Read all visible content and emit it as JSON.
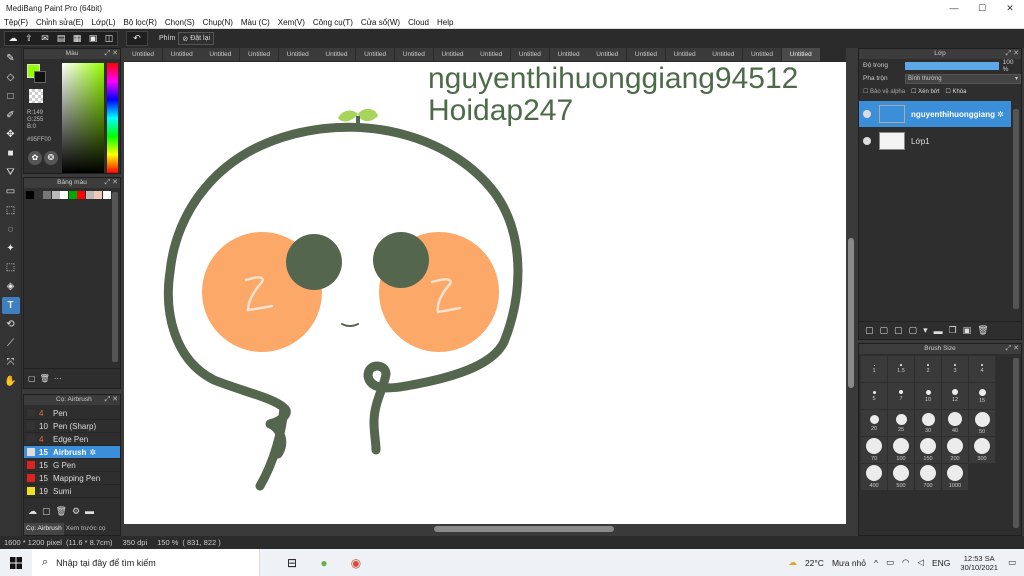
{
  "window": {
    "title": "MediBang Paint Pro (64bit)",
    "minimize": "—",
    "maximize": "☐",
    "close": "✕"
  },
  "menu": [
    "Tệp(F)",
    "Chỉnh sửa(E)",
    "Lớp(L)",
    "Bộ lọc(R)",
    "Chọn(S)",
    "Chụp(N)",
    "Màu (C)",
    "Xem(V)",
    "Công cụ(T)",
    "Cửa sổ(W)",
    "Cloud",
    "Help"
  ],
  "toolbar": {
    "phim_label": "Phím",
    "reset_label": "Đặt lại"
  },
  "tabs": [
    "Untitled",
    "Untitled",
    "Untitled",
    "Untitled",
    "Untitled",
    "Untitled",
    "Untitled",
    "Untitled",
    "Untitled",
    "Untitled",
    "Untitled",
    "Untitled",
    "Untitled",
    "Untitled",
    "Untitled",
    "Untitled",
    "Untitled",
    "Untitled"
  ],
  "color_panel": {
    "title": "Màu",
    "r": "R:149",
    "g": "G:255",
    "b": "B:0",
    "hex": "#95FF00",
    "fg_color": "#95ff00",
    "bg_color": "#111111"
  },
  "palette_panel": {
    "title": "Bảng màu",
    "swatches": [
      "#000000",
      "#333333",
      "#777777",
      "#bbbbbb",
      "#ffffff",
      "#00aa00",
      "#ff0000",
      "#bbbbbb",
      "#f4c8b8",
      "#ffffff"
    ],
    "dots": "···"
  },
  "brush_panel": {
    "title": "Cọ: Airbrush",
    "brushes": [
      {
        "size": "4",
        "name": "Pen",
        "color": "#333333"
      },
      {
        "size": "10",
        "name": "Pen (Sharp)",
        "color": "#333333"
      },
      {
        "size": "4",
        "name": "Edge Pen",
        "color": "#333333"
      },
      {
        "size": "15",
        "name": "Airbrush",
        "color": "#95ff00",
        "active": true
      },
      {
        "size": "15",
        "name": "G Pen",
        "color": "#dd2222"
      },
      {
        "size": "15",
        "name": "Mapping Pen",
        "color": "#dd2222"
      },
      {
        "size": "19",
        "name": "Sumi",
        "color": "#f0e020"
      }
    ],
    "bottom_tabs": [
      "Cọ: Airbrush",
      "Xem trước cọ"
    ]
  },
  "canvas": {
    "watermark_line1": "nguyenthihuonggiang94512",
    "watermark_line2": "Hoidap247",
    "line_color": "#55664f",
    "cheek_color": "#fba868",
    "sprout_color": "#a7d45a"
  },
  "layer_panel": {
    "title": "Lớp",
    "opacity_label": "Độ trong",
    "opacity_value": "100 %",
    "opacity_fraction": 1.0,
    "blend_label": "Pha trộn",
    "blend_value": "Bình thường",
    "protect_alpha": "Bảo vệ alpha",
    "clipping": "Xén bớt",
    "lock": "Khóa",
    "layers": [
      {
        "name": "nguyenthihuonggiang",
        "active": true
      },
      {
        "name": "Lớp1",
        "active": false
      }
    ]
  },
  "brush_size_panel": {
    "title": "Brush Size",
    "sizes": [
      "1",
      "1.5",
      "2",
      "3",
      "4",
      "5",
      "7",
      "10",
      "12",
      "15",
      "20",
      "25",
      "30",
      "40",
      "50",
      "70",
      "100",
      "150",
      "200",
      "300",
      "400",
      "500",
      "700",
      "1000"
    ]
  },
  "status": {
    "pixels": "1600 * 1200 pixel",
    "cm": "(11.6 * 8.7cm)",
    "dpi": "350 dpi",
    "zoom": "150 %",
    "coords": "( 831, 822 )"
  },
  "taskbar": {
    "search_placeholder": "Nhập tại đây để tìm kiếm",
    "temp": "22°C",
    "weather": "Mưa nhỏ",
    "lang": "ENG",
    "time": "12:53 SA",
    "date": "30/10/2021"
  }
}
